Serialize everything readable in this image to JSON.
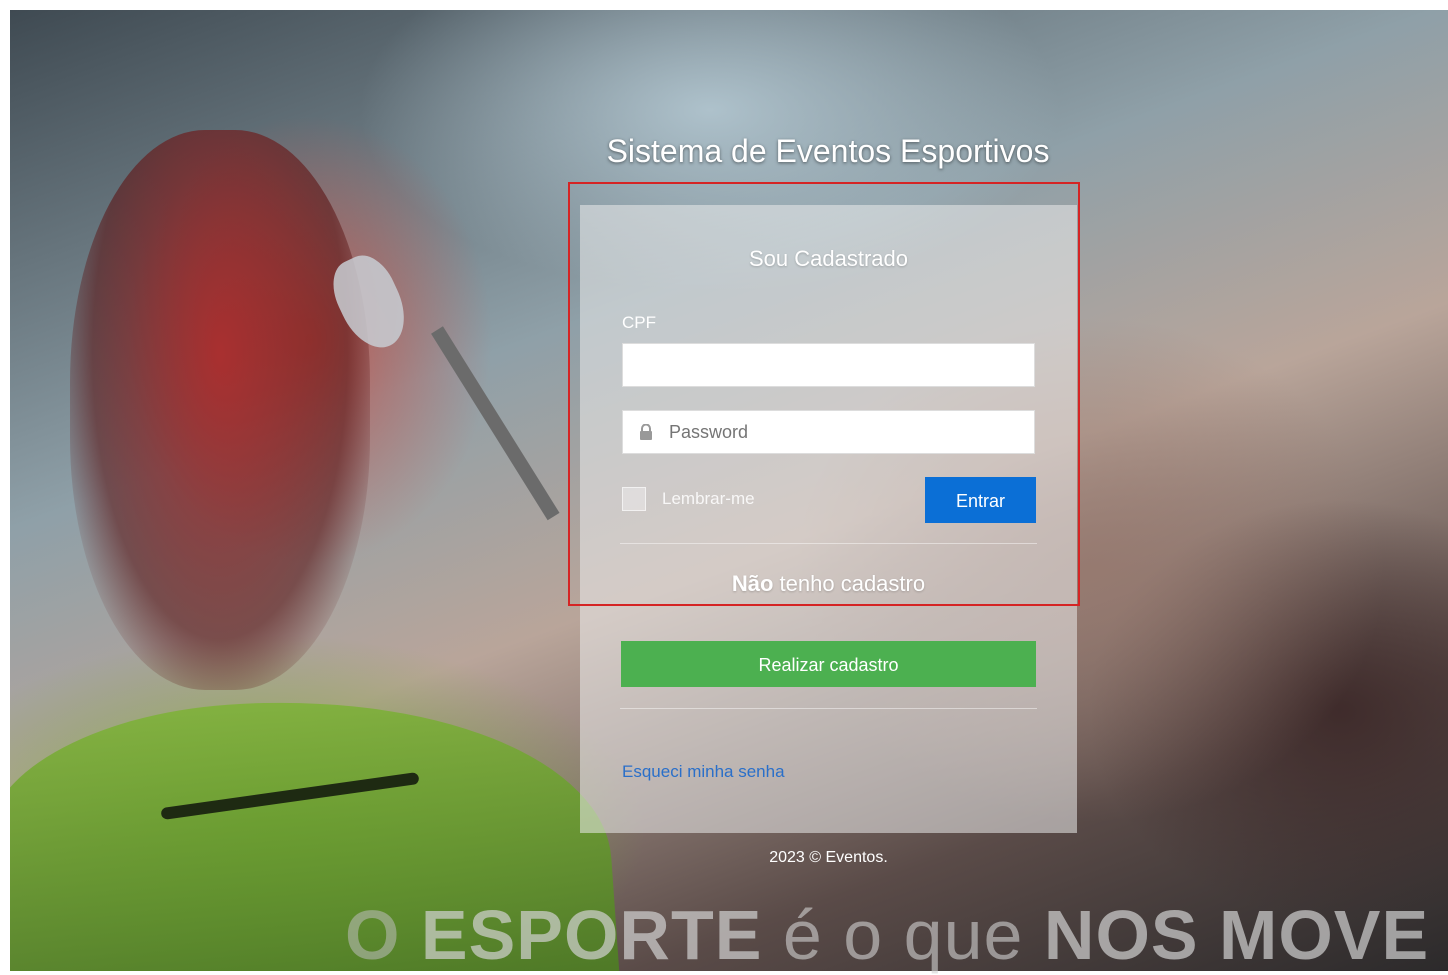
{
  "header": {
    "title": "Sistema de Eventos Esportivos"
  },
  "login": {
    "section_title": "Sou Cadastrado",
    "cpf_label": "CPF",
    "cpf_value": "",
    "password_placeholder": "Password",
    "remember_label": "Lembrar-me",
    "submit_label": "Entrar"
  },
  "register": {
    "title_bold": "Não",
    "title_rest": " tenho cadastro",
    "button_label": "Realizar cadastro"
  },
  "forgot_link": "Esqueci minha senha",
  "footer": {
    "copyright": "2023 © Eventos."
  },
  "slogan": {
    "part1": "O ",
    "part2": "ESPORTE",
    "part3": " é o que ",
    "part4": "NOS MOVE"
  },
  "colors": {
    "primary": "#0b6fd6",
    "success": "#4cb050",
    "link": "#2a6fc9",
    "highlight": "#d52424"
  },
  "icons": {
    "password_field": "lock-icon"
  }
}
